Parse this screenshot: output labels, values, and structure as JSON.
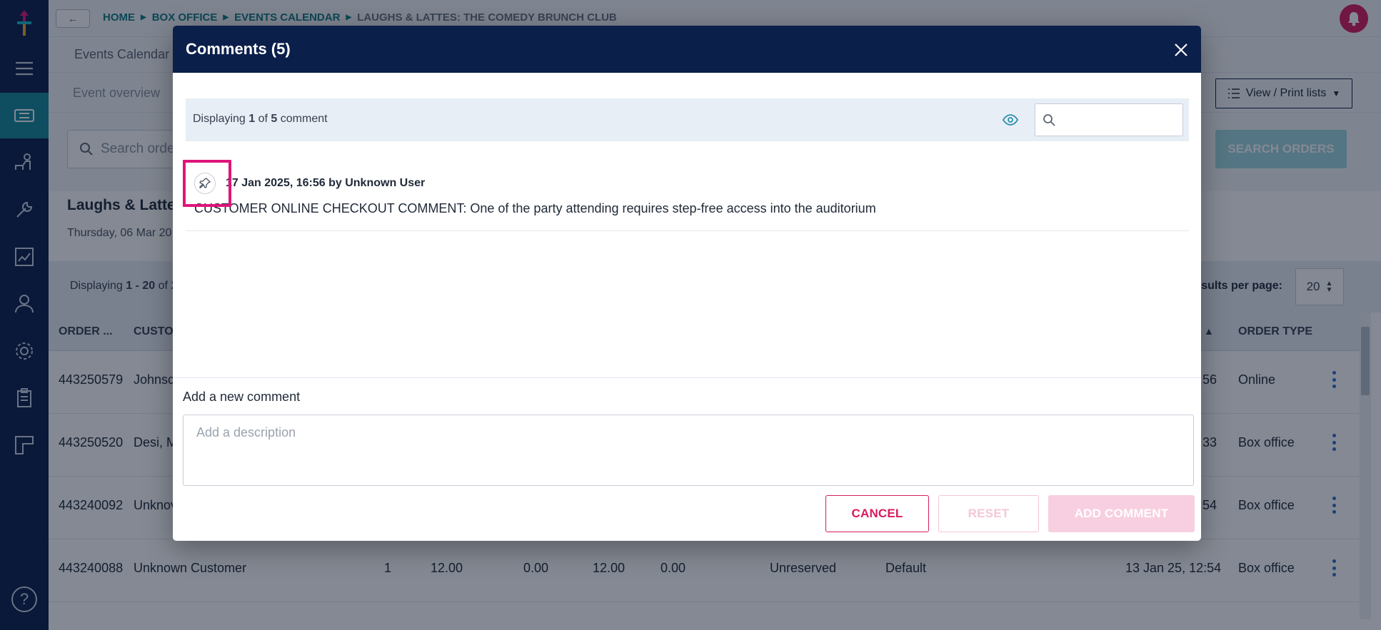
{
  "breadcrumb": {
    "items": [
      "HOME",
      "BOX OFFICE",
      "EVENTS CALENDAR"
    ],
    "current": "LAUGHS & LATTES: THE COMEDY BRUNCH CLUB"
  },
  "page": {
    "tab_primary": "Events Calendar",
    "tab_secondary": "Event overview",
    "view_print_label": "View / Print lists",
    "search_placeholder": "Search orde",
    "search_button": "SEARCH ORDERS",
    "event_title": "Laughs & Lattes",
    "event_date": "Thursday, 06 Mar 20",
    "list_display_prefix": "Displaying",
    "list_display_range": "1 - 20",
    "list_display_suffix": "of 2",
    "results_per_page_label": "esults per page:",
    "results_per_page_value": "20",
    "columns": {
      "order": "ORDER ...",
      "customer": "CUSTO",
      "order_type": "ORDER TYPE"
    },
    "rows": [
      {
        "order": "443250579",
        "customer": "Johnsc",
        "date": "56",
        "type": "Online"
      },
      {
        "order": "443250520",
        "customer": "Desi, M",
        "date": "33",
        "type": "Box office"
      },
      {
        "order": "443240092",
        "customer": "Unknov",
        "date": "54",
        "type": "Box office"
      },
      {
        "order": "443240088",
        "customer": "Unknown Customer",
        "qty": "1",
        "price": "12.00",
        "fee": "0.00",
        "total": "12.00",
        "paid": "0.00",
        "seating": "Unreserved",
        "price_band": "Default",
        "date": "13 Jan 25, 12:54",
        "type": "Box office"
      }
    ]
  },
  "modal": {
    "title": "Comments (5)",
    "display_prefix": "Displaying",
    "display_current": "1",
    "display_of": "of",
    "display_total": "5",
    "display_suffix": "comment",
    "search_placeholder": "",
    "comments": [
      {
        "meta": "17 Jan 2025, 16:56 by Unknown User",
        "text": "CUSTOMER ONLINE CHECKOUT COMMENT: One of the party attending requires step-free access into the auditorium"
      }
    ],
    "new_comment_label": "Add a new comment",
    "new_comment_placeholder": "Add a description",
    "cancel_label": "CANCEL",
    "reset_label": "RESET",
    "add_label": "ADD COMMENT"
  },
  "colors": {
    "navy": "#0b1f4b",
    "teal": "#15889a",
    "pink": "#d81b60",
    "highlight": "#e0157a"
  }
}
